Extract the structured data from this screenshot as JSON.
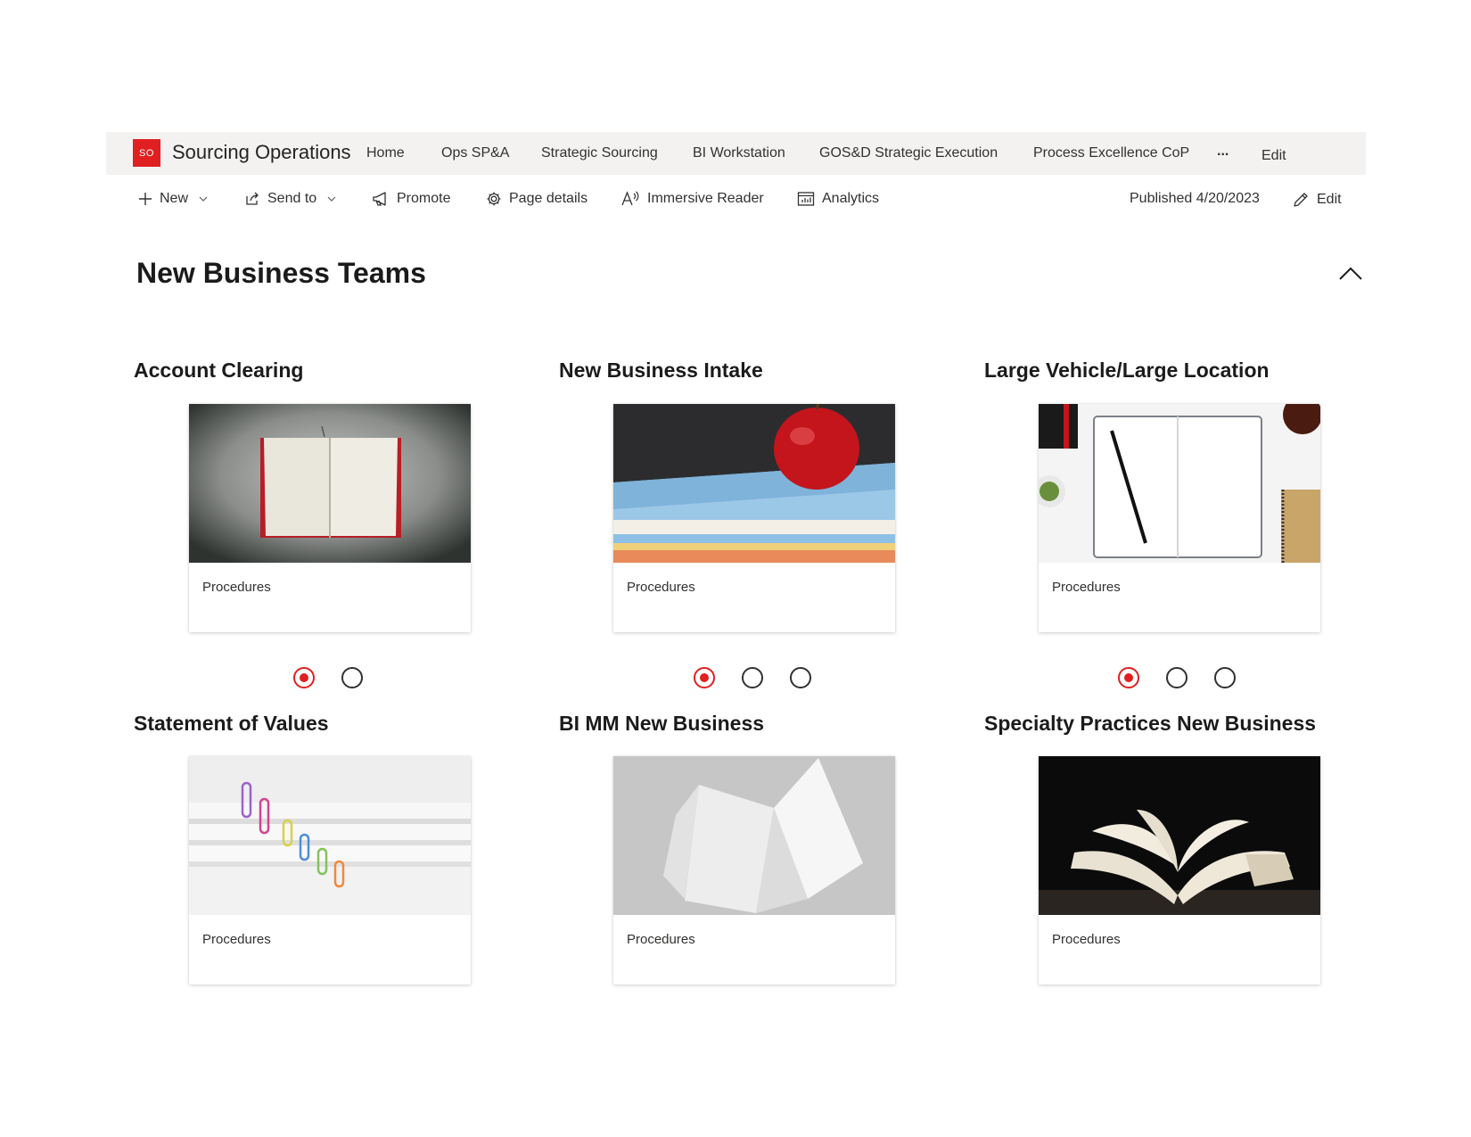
{
  "site": {
    "logo_text": "SO",
    "title": "Sourcing Operations",
    "brand_color": "#e02020",
    "nav": [
      "Home",
      "Ops SP&A",
      "Strategic Sourcing",
      "BI Workstation",
      "GOS&D Strategic Execution",
      "Process Excellence CoP"
    ],
    "more_label": "...",
    "edit_label": "Edit"
  },
  "commandbar": {
    "new_label": "New",
    "send_to_label": "Send to",
    "promote_label": "Promote",
    "page_details_label": "Page details",
    "immersive_reader_label": "Immersive Reader",
    "analytics_label": "Analytics",
    "published_label": "Published 4/20/2023",
    "edit_label": "Edit"
  },
  "section": {
    "title": "New Business Teams"
  },
  "teams": [
    {
      "title": "Account Clearing",
      "card_label": "Procedures",
      "image": "open-book-on-grey",
      "slides": 2,
      "active_slide": 1
    },
    {
      "title": "New Business Intake",
      "card_label": "Procedures",
      "image": "apple-on-books",
      "slides": 3,
      "active_slide": 1
    },
    {
      "title": "Large Vehicle/Large Location",
      "card_label": "Procedures",
      "image": "notebook-and-pen",
      "slides": 3,
      "active_slide": 1
    },
    {
      "title": "Statement of Values",
      "card_label": "Procedures",
      "image": "paper-clips-on-paper"
    },
    {
      "title": "BI MM New Business",
      "card_label": "Procedures",
      "image": "open-blank-book"
    },
    {
      "title": "Specialty Practices New Business",
      "card_label": "Procedures",
      "image": "open-book-dark"
    }
  ]
}
